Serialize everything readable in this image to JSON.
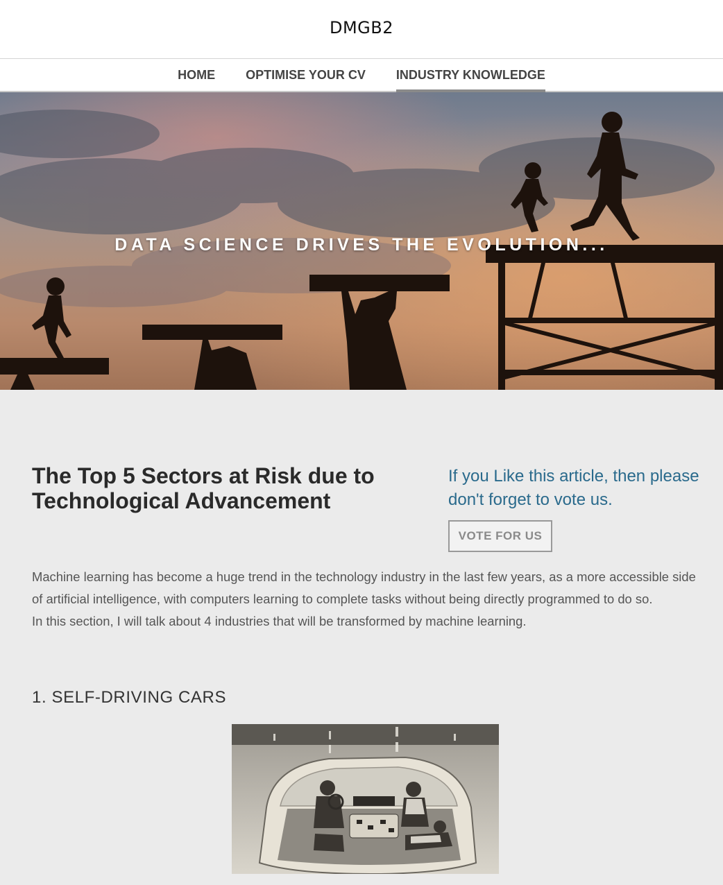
{
  "site": {
    "title": "DMGB2"
  },
  "nav": {
    "items": [
      {
        "label": "HOME",
        "active": false
      },
      {
        "label": "OPTIMISE YOUR CV",
        "active": false
      },
      {
        "label": "INDUSTRY KNOWLEDGE",
        "active": true
      }
    ]
  },
  "hero": {
    "tagline": "DATA SCIENCE DRIVES THE EVOLUTION..."
  },
  "article": {
    "title": "The Top 5 Sectors at Risk due to Technological Advancement",
    "vote_prompt": "If you Like this article, then please don't forget to vote us.",
    "vote_button": "VOTE FOR US",
    "intro_paragraph_1": "Machine learning has become a huge trend in the technology industry in the last few years, as a more accessible side of artificial intelligence, with computers learning to complete tasks without being directly programmed to do so.",
    "intro_paragraph_2": "In this section, I will talk about 4 industries that will be transformed by machine learning.",
    "section_1_heading": "1. SELF-DRIVING CARS"
  },
  "colors": {
    "page_background": "#ebebeb",
    "header_background": "#ffffff",
    "vote_text": "#2a6a8c",
    "title_text": "#2a2a2a",
    "body_text": "#555555"
  }
}
